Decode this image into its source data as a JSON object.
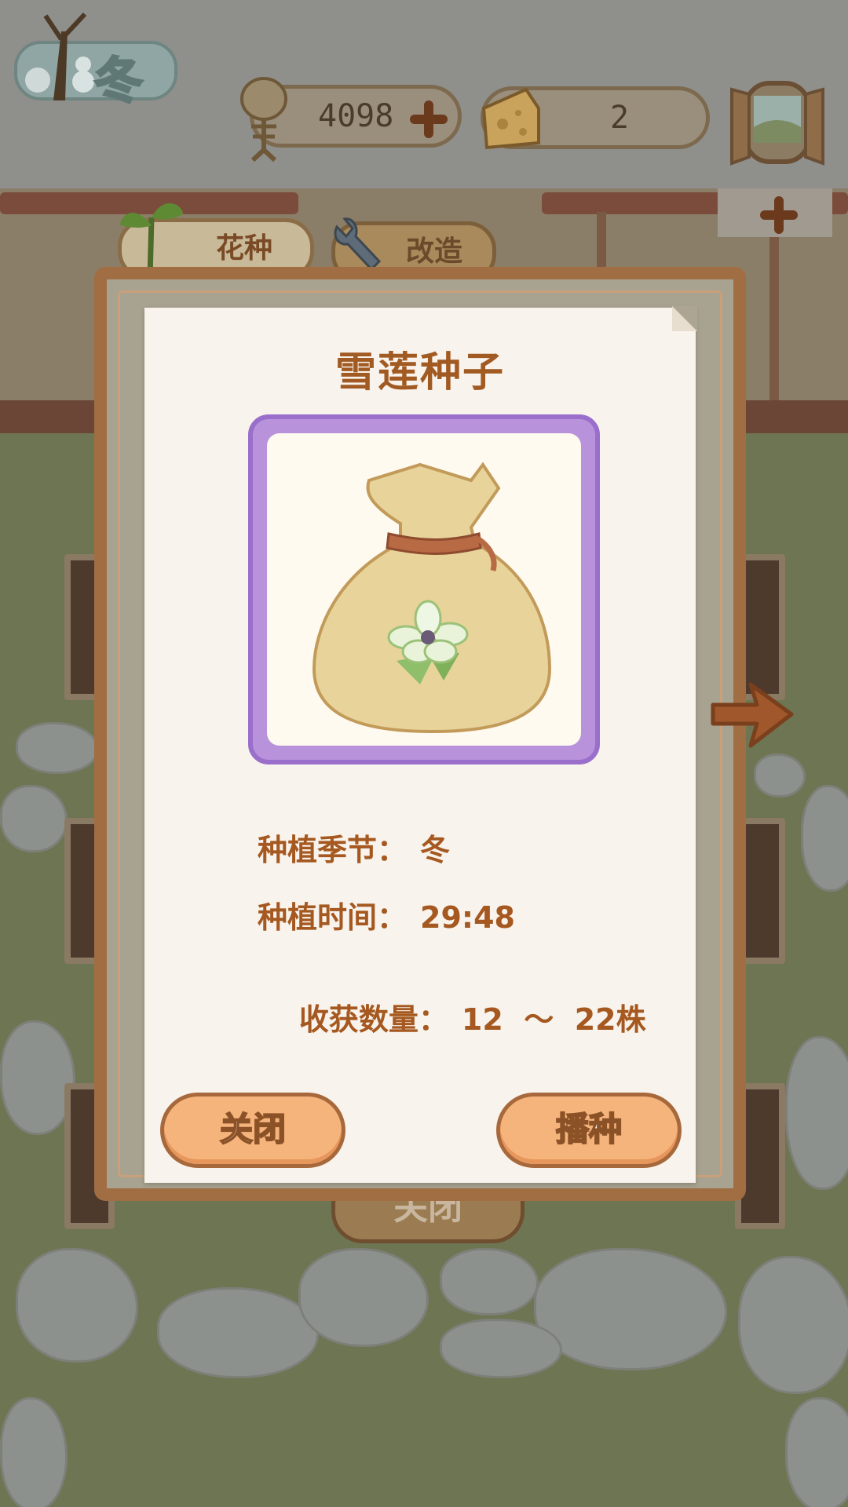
{
  "hud": {
    "season": "冬",
    "fish_bones": "4098",
    "cheese": "2"
  },
  "tabs": {
    "flower_seeds": "花种",
    "upgrade": "改造"
  },
  "popup": {
    "title": "雪莲种子",
    "item_icon": "seed-bag-with-snow-lotus",
    "season_label": "种植季节：",
    "season_value": "冬",
    "time_label": "种植时间：",
    "time_value": "29:48",
    "harvest_label": "收获数量：",
    "harvest_value": "12  ～  22株",
    "close_button": "关闭",
    "sow_button": "播种"
  },
  "background": {
    "close_button": "关闭"
  },
  "colors": {
    "title": "#a15a22",
    "button": "#f6b47d",
    "item_frame": "#b893db",
    "paper": "#f8f3ec"
  }
}
